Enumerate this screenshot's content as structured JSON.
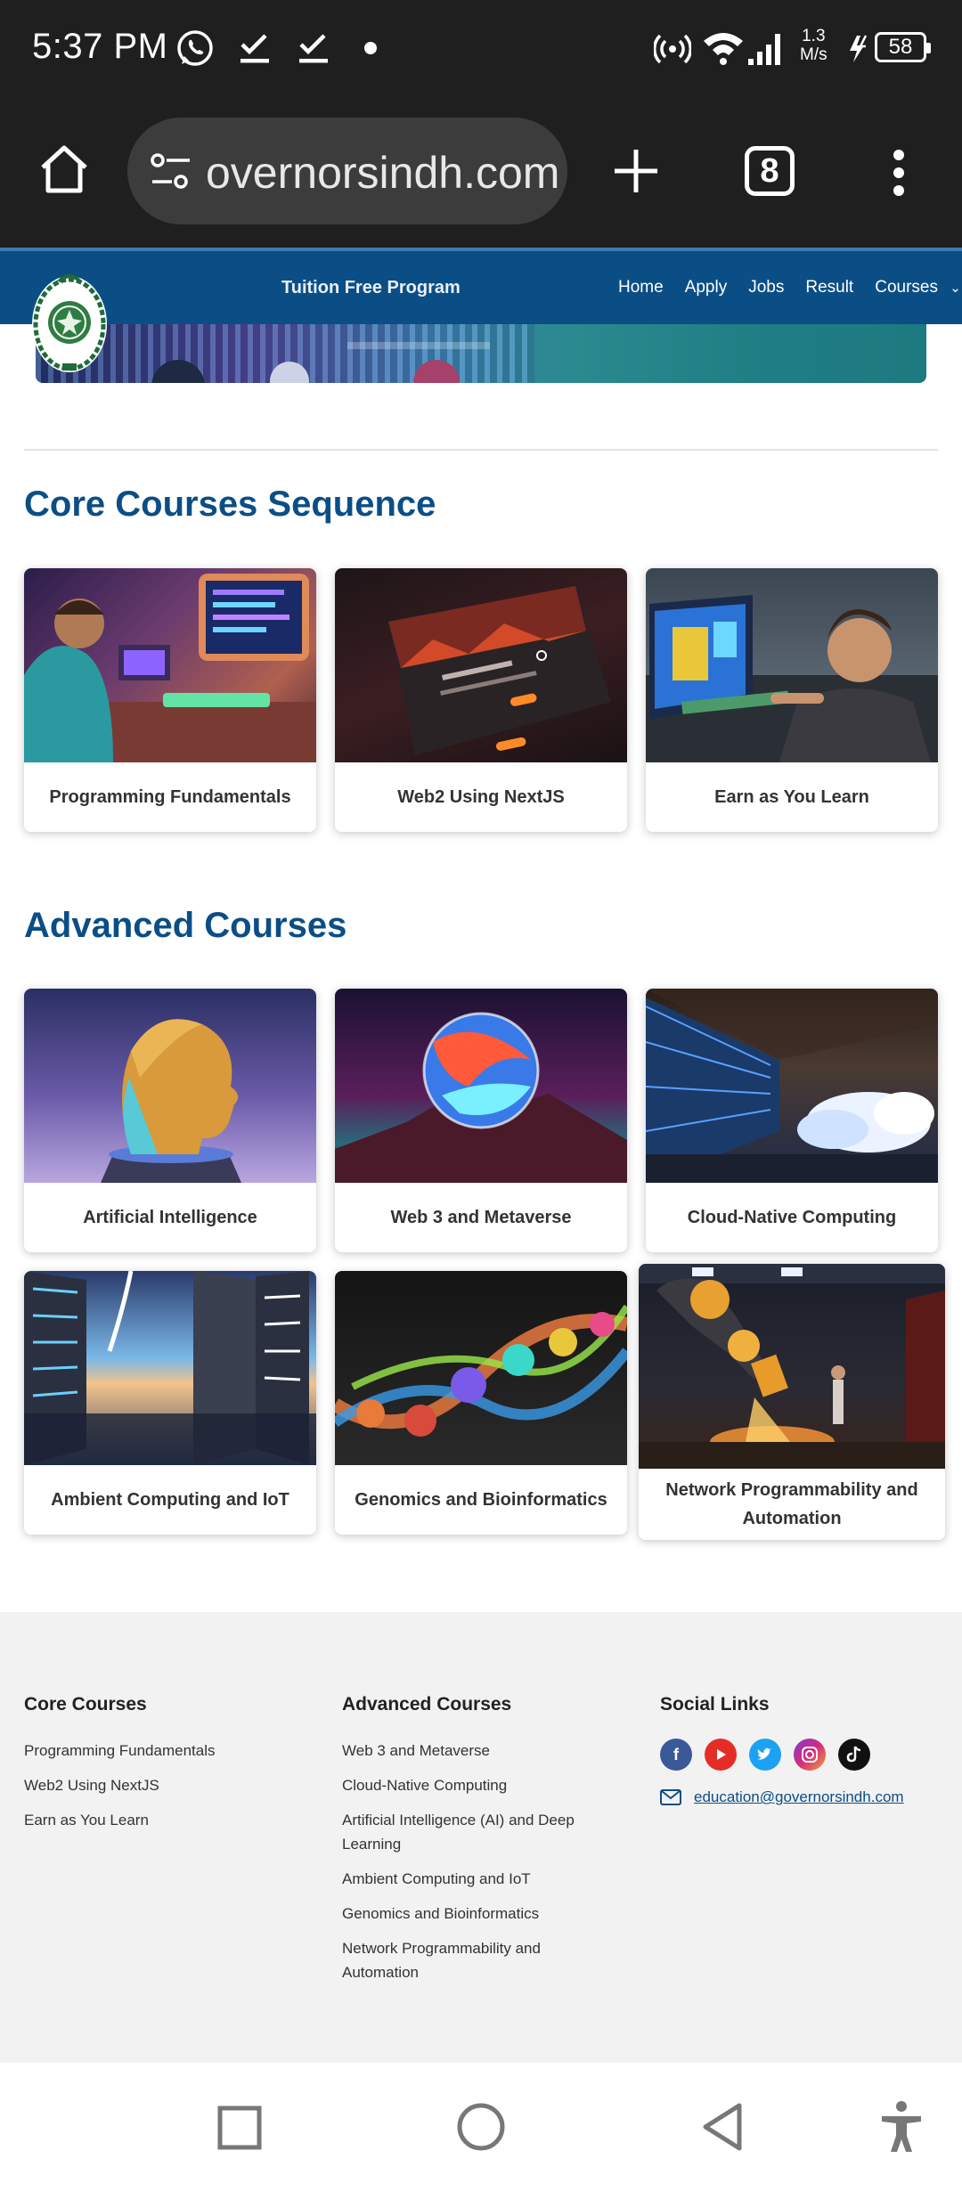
{
  "status_bar": {
    "time": "5:37 PM",
    "speed_value": "1.3",
    "speed_unit": "M/s",
    "battery": "58",
    "icons": [
      "whatsapp-icon",
      "check-icon",
      "check-icon",
      "dot-icon",
      "hotspot-icon",
      "wifi-icon",
      "signal-icon",
      "charging-icon"
    ]
  },
  "browser": {
    "url": "overnorsindh.com",
    "tab_count": "8",
    "icons": [
      "home-icon",
      "tune-icon",
      "plus-icon",
      "more-vert-icon"
    ]
  },
  "site_nav": {
    "title": "Tuition Free Program",
    "links": [
      "Home",
      "Apply",
      "Jobs",
      "Result",
      "Courses"
    ],
    "courses_caret": "⌄"
  },
  "core": {
    "title": "Core Courses Sequence",
    "cards": [
      "Programming Fundamentals",
      "Web2 Using NextJS",
      "Earn as You Learn"
    ]
  },
  "advanced": {
    "title": "Advanced Courses",
    "cards": [
      "Artificial Intelligence",
      "Web 3 and Metaverse",
      "Cloud-Native Computing",
      "Ambient Computing and IoT",
      "Genomics and Bioinformatics",
      "Network Programmability and Automation"
    ]
  },
  "footer": {
    "core_heading": "Core Courses",
    "core_links": [
      "Programming Fundamentals",
      "Web2 Using NextJS",
      "Earn as You Learn"
    ],
    "advanced_heading": "Advanced Courses",
    "advanced_links": [
      "Web 3 and Metaverse",
      "Cloud-Native Computing",
      "Artificial Intelligence (AI) and Deep Learning",
      "Ambient Computing and IoT",
      "Genomics and Bioinformatics",
      "Network Programmability and Automation"
    ],
    "social_heading": "Social Links",
    "socials": [
      "facebook-icon",
      "youtube-icon",
      "twitter-icon",
      "instagram-icon",
      "tiktok-icon"
    ],
    "email": "education@governorsindh.com"
  },
  "colors": {
    "brand_blue": "#0b4e86",
    "status_bg": "#1f1f1f",
    "footer_bg": "#f2f2f2"
  }
}
